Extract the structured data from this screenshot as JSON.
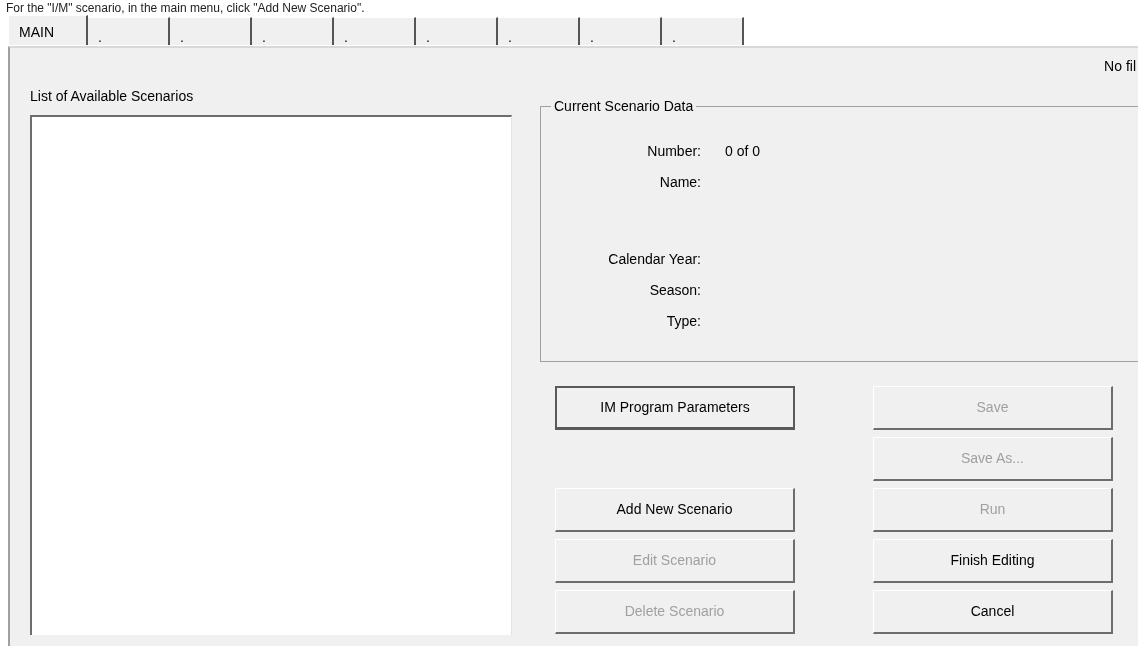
{
  "caption": "For the \"I/M\" scenario, in the main menu, click \"Add New Scenario\".",
  "tabs": [
    {
      "label": "MAIN",
      "selected": true
    },
    {
      "label": ".",
      "selected": false
    },
    {
      "label": ".",
      "selected": false
    },
    {
      "label": ".",
      "selected": false
    },
    {
      "label": ".",
      "selected": false
    },
    {
      "label": ".",
      "selected": false
    },
    {
      "label": ".",
      "selected": false
    },
    {
      "label": ".",
      "selected": false
    },
    {
      "label": ".",
      "selected": false
    }
  ],
  "file_status": "No fil",
  "scenario_list": {
    "label": "List of Available Scenarios"
  },
  "current_scenario": {
    "title": "Current Scenario Data",
    "fields": [
      {
        "label": "Number:",
        "value": "0 of 0"
      },
      {
        "label": "Name:"
      },
      {
        "label": "Calendar Year:"
      },
      {
        "label": "Season:"
      },
      {
        "label": "Type:"
      }
    ]
  },
  "left_buttons": [
    {
      "label": "IM Program Parameters",
      "disabled": false,
      "focused": true
    },
    {
      "label": "Add New Scenario",
      "disabled": false,
      "focused": false
    },
    {
      "label": "Edit Scenario",
      "disabled": true,
      "focused": false
    },
    {
      "label": "Delete Scenario",
      "disabled": true,
      "focused": false
    }
  ],
  "right_buttons": [
    {
      "label": "Save",
      "disabled": true,
      "focused": false
    },
    {
      "label": "Save As...",
      "disabled": true,
      "focused": false
    },
    {
      "label": "Run",
      "disabled": true,
      "focused": false
    },
    {
      "label": "Finish Editing",
      "disabled": false,
      "focused": false
    },
    {
      "label": "Cancel",
      "disabled": false,
      "focused": false
    }
  ]
}
